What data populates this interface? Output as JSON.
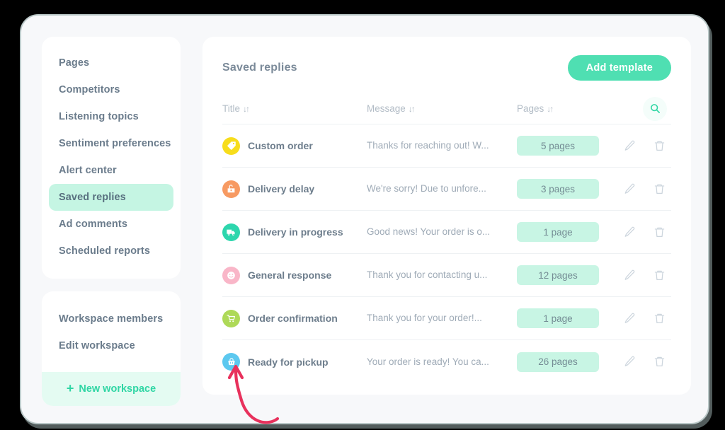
{
  "window": {
    "background_color": "#f7f8fa",
    "border_color": "#b9c7c7"
  },
  "sidebar": {
    "items": [
      {
        "label": "Pages",
        "active": false
      },
      {
        "label": "Competitors",
        "active": false
      },
      {
        "label": "Listening topics",
        "active": false
      },
      {
        "label": "Sentiment preferences",
        "active": false
      },
      {
        "label": "Alert center",
        "active": false
      },
      {
        "label": "Saved replies",
        "active": true
      },
      {
        "label": "Ad comments",
        "active": false
      },
      {
        "label": "Scheduled reports",
        "active": false
      }
    ],
    "workspace_items": [
      {
        "label": "Workspace members"
      },
      {
        "label": "Edit workspace"
      }
    ],
    "new_workspace": {
      "label": "New workspace",
      "plus_icon": "+",
      "color": "#2fd6a4",
      "background": "#e4fbf2"
    },
    "active_background": "#c5f5e3"
  },
  "main": {
    "title": "Saved replies",
    "add_button": {
      "label": "Add template",
      "color": "#4fdfb2"
    },
    "columns": [
      {
        "label": "Title",
        "sort_icon": "↓↑"
      },
      {
        "label": "Message",
        "sort_icon": "↓↑"
      },
      {
        "label": "Pages",
        "sort_icon": "↓↑"
      }
    ],
    "search_icon": "search-icon",
    "search_icon_color": "#2fd6a4",
    "badge_color": "#c8f5e4",
    "rows": [
      {
        "icon": "tag-icon",
        "icon_color": "#f7dd1c",
        "title": "Custom order",
        "message": "Thanks for reaching out! W...",
        "pages": "5 pages",
        "edit_icon": "pencil-icon",
        "delete_icon": "trash-icon"
      },
      {
        "icon": "open-box-icon",
        "icon_color": "#f79a62",
        "title": "Delivery delay",
        "message": "We're sorry! Due to unfore...",
        "pages": "3 pages",
        "edit_icon": "pencil-icon",
        "delete_icon": "trash-icon"
      },
      {
        "icon": "truck-icon",
        "icon_color": "#2dd6ad",
        "title": "Delivery in progress",
        "message": "Good news! Your order is o...",
        "pages": "1 page",
        "edit_icon": "pencil-icon",
        "delete_icon": "trash-icon"
      },
      {
        "icon": "smiley-icon",
        "icon_color": "#f9b6c8",
        "title": "General response",
        "message": "Thank you for contacting u...",
        "pages": "12 pages",
        "edit_icon": "pencil-icon",
        "delete_icon": "trash-icon"
      },
      {
        "icon": "shopping-cart-icon",
        "icon_color": "#aed958",
        "title": "Order confirmation",
        "message": "Thank you for your order!...",
        "pages": "1 page",
        "edit_icon": "pencil-icon",
        "delete_icon": "trash-icon"
      },
      {
        "icon": "shopping-basket-icon",
        "icon_color": "#5cc8ef",
        "title": "Ready for pickup",
        "message": "Your order is ready! You ca...",
        "pages": "26 pages",
        "edit_icon": "pencil-icon",
        "delete_icon": "trash-icon"
      }
    ]
  },
  "annotation": {
    "arrow_color": "#e8315c",
    "points_to": "Ready for pickup row icon"
  }
}
